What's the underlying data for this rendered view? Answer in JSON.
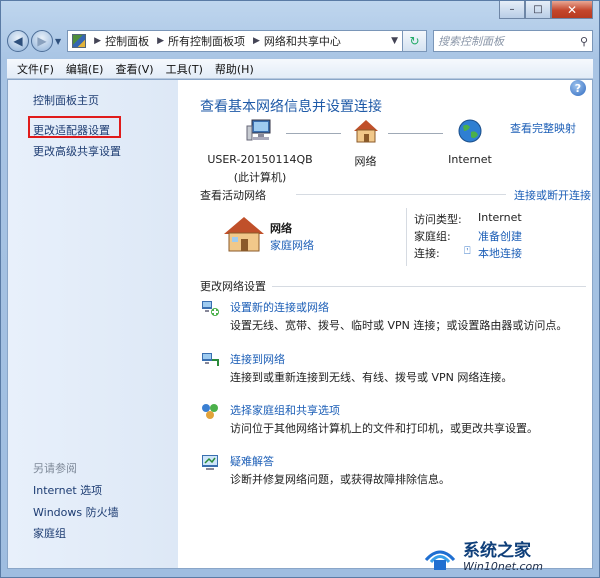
{
  "window": {
    "caption_buttons": [
      "–",
      "□",
      "✕"
    ]
  },
  "address": {
    "crumbs": [
      "控制面板",
      "所有控制面板项",
      "网络和共享中心"
    ],
    "search_placeholder": "搜索控制面板"
  },
  "menu": [
    "文件(F)",
    "编辑(E)",
    "查看(V)",
    "工具(T)",
    "帮助(H)"
  ],
  "sidebar": {
    "home": "控制面板主页",
    "items": [
      "更改适配器设置",
      "更改高级共享设置"
    ],
    "see_also_label": "另请参阅",
    "see_also": [
      "Internet 选项",
      "Windows 防火墙",
      "家庭组"
    ]
  },
  "main": {
    "title": "查看基本网络信息并设置连接",
    "full_map": "查看完整映射",
    "map": {
      "computer_line1": "USER-20150114QB",
      "computer_line2": "(此计算机)",
      "network": "网络",
      "internet": "Internet"
    },
    "active": {
      "title": "查看活动网络",
      "connect_link": "连接或断开连接",
      "name": "网络",
      "type": "家庭网络",
      "access_label": "访问类型:",
      "access_value": "Internet",
      "homegroup_label": "家庭组:",
      "homegroup_value": "准备创建",
      "conn_label": "连接:",
      "conn_value": "本地连接"
    },
    "change_title": "更改网络设置",
    "tasks": [
      {
        "title": "设置新的连接或网络",
        "desc": "设置无线、宽带、拨号、临时或 VPN 连接；或设置路由器或访问点。"
      },
      {
        "title": "连接到网络",
        "desc": "连接到或重新连接到无线、有线、拨号或 VPN 网络连接。"
      },
      {
        "title": "选择家庭组和共享选项",
        "desc": "访问位于其他网络计算机上的文件和打印机，或更改共享设置。"
      },
      {
        "title": "疑难解答",
        "desc": "诊断并修复网络问题，或获得故障排除信息。"
      }
    ]
  },
  "watermark": {
    "title": "系统之家",
    "url": "Win10net.com"
  }
}
